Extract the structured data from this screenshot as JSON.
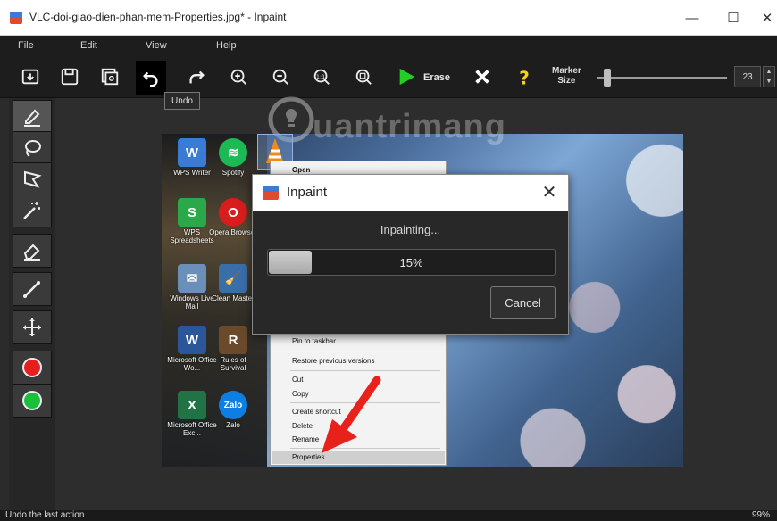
{
  "window": {
    "title": "VLC-doi-giao-dien-phan-mem-Properties.jpg* - Inpaint",
    "minimize": "—",
    "maximize": "☐",
    "close": "✕"
  },
  "menu": [
    "File",
    "Edit",
    "View",
    "Help"
  ],
  "toolbar": {
    "erase_label": "Erase",
    "marker_label_1": "Marker",
    "marker_label_2": "Size",
    "marker_size": "23",
    "marker_slider_min_fraction": 0.05,
    "undo_tooltip": "Undo",
    "spin_up": "▲",
    "spin_down": "▼"
  },
  "watermark": {
    "text": "uantrimang"
  },
  "desktop_icons": [
    {
      "label": "WPS Writer",
      "glyph": "W",
      "color": "#3a7bd5"
    },
    {
      "label": "Spotify",
      "glyph": "≋",
      "color": "#1db954"
    },
    {
      "label": "WPS Spreadsheets",
      "glyph": "S",
      "color": "#2aa84a"
    },
    {
      "label": "Opera Browser",
      "glyph": "O",
      "color": "#d91c1c"
    },
    {
      "label": "Windows Live Mail",
      "glyph": "✉",
      "color": "#6a8fb8"
    },
    {
      "label": "Clean Master",
      "glyph": "🧹",
      "color": "#3a6ea8"
    },
    {
      "label": "Microsoft Office Wo...",
      "glyph": "W",
      "color": "#2b579a"
    },
    {
      "label": "Rules of Survival",
      "glyph": "R",
      "color": "#6b4a2b"
    },
    {
      "label": "Microsoft Office Exc...",
      "glyph": "X",
      "color": "#217346"
    },
    {
      "label": "Zalo",
      "glyph": "Zalo",
      "color": "#0d7ee3"
    }
  ],
  "context_menu": {
    "open": "Open",
    "items": [
      "Pin to taskbar",
      "Restore previous versions",
      "Cut",
      "Copy",
      "Create shortcut",
      "Delete",
      "Rename",
      "Properties"
    ]
  },
  "dialog": {
    "title": "Inpaint",
    "status": "Inpainting...",
    "progress_percent": 15,
    "progress_text": "15%",
    "cancel": "Cancel",
    "close": "✕"
  },
  "colors": {
    "foreground_color": "#e81e1e",
    "background_color": "#19c13a",
    "erase_play": "#22d022",
    "help_yellow": "#f6d21a"
  },
  "statusbar": {
    "message": "Undo the last action",
    "zoom": "99%"
  }
}
